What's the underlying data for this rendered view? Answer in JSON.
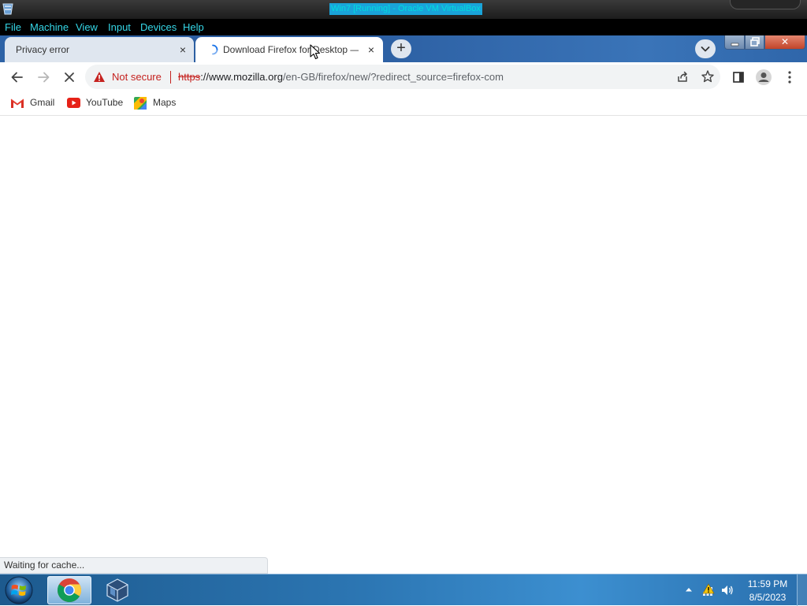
{
  "host_window": {
    "title": "Win7 [Running] - Oracle VM VirtualBox",
    "menu": [
      "File",
      "Machine",
      "View",
      "Input",
      "Devices",
      "Help"
    ]
  },
  "browser": {
    "tabs": [
      {
        "title": "Privacy error",
        "active": false
      },
      {
        "title": "Download Firefox for Desktop —",
        "active": true,
        "loading": true
      }
    ],
    "new_tab_label": "+",
    "close_label": "×",
    "window_close_label": "✕",
    "omnibox": {
      "security_label": "Not secure",
      "url_scheme": "https",
      "url_host": "://www.mozilla.org",
      "url_path": "/en-GB/firefox/new/?redirect_source=firefox-com"
    },
    "bookmarks": [
      "Gmail",
      "YouTube",
      "Maps"
    ],
    "status_text": "Waiting for cache..."
  },
  "taskbar": {
    "time": "11:59 PM",
    "date": "8/5/2023"
  },
  "colors": {
    "not_secure_red": "#c5221f",
    "menu_cyan": "#35d6e6",
    "tab_strip_blue": "#2e63a6"
  }
}
